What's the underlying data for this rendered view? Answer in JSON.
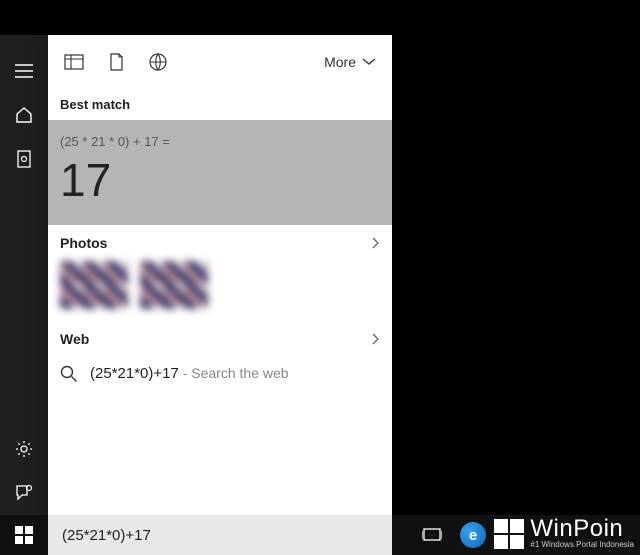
{
  "sidebar": {
    "items": [
      "menu-icon",
      "home-icon",
      "app-icon",
      "settings-icon",
      "feedback-icon"
    ]
  },
  "header": {
    "more_label": "More"
  },
  "best_match": {
    "label": "Best match",
    "expression": "(25 * 21 * 0) + 17 =",
    "result": "17"
  },
  "sections": {
    "photos": {
      "title": "Photos"
    },
    "web": {
      "title": "Web",
      "query": "(25*21*0)+17",
      "hint": " - Search the web"
    }
  },
  "search": {
    "value": "(25*21*0)+17"
  },
  "watermark": {
    "title": "WinPoin",
    "subtitle": "#1 Windows Portal Indonesia"
  }
}
